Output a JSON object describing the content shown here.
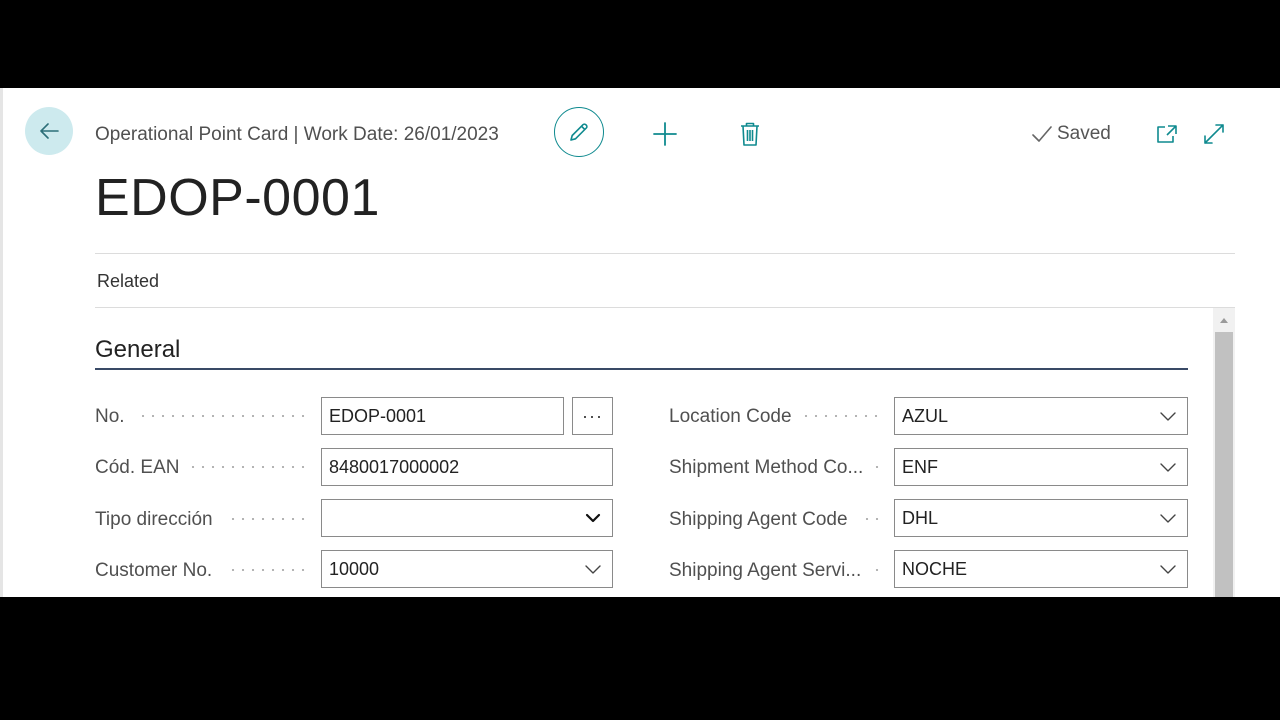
{
  "header": {
    "title": "Operational Point Card | Work Date: 26/01/2023",
    "saved_label": "Saved"
  },
  "record": {
    "title": "EDOP-0001"
  },
  "nav": {
    "related_label": "Related"
  },
  "section": {
    "title": "General"
  },
  "fields": {
    "no": {
      "label": "No.",
      "value": "EDOP-0001",
      "lookup_label": "···"
    },
    "ean": {
      "label": "Cód. EAN",
      "value": "8480017000002"
    },
    "tipo_direccion": {
      "label": "Tipo dirección",
      "value": ""
    },
    "customer_no": {
      "label": "Customer No.",
      "value": "10000"
    },
    "location_code": {
      "label": "Location Code",
      "value": "AZUL"
    },
    "shipment_method": {
      "label": "Shipment Method Co...",
      "value": "ENF"
    },
    "shipping_agent": {
      "label": "Shipping Agent Code",
      "value": "DHL"
    },
    "shipping_agent_service": {
      "label": "Shipping Agent Servi...",
      "value": "NOCHE"
    }
  },
  "icons": {
    "back": "arrow-left-icon",
    "edit": "pencil-icon",
    "add": "plus-icon",
    "delete": "trash-icon",
    "saved": "checkmark-icon",
    "open_new_window": "open-in-new-window-icon",
    "expand": "expand-icon",
    "dropdown": "chevron-down-icon"
  },
  "colors": {
    "accent": "#0f8a8f",
    "back_button_bg": "#cdeaee",
    "section_rule": "#394a66"
  }
}
